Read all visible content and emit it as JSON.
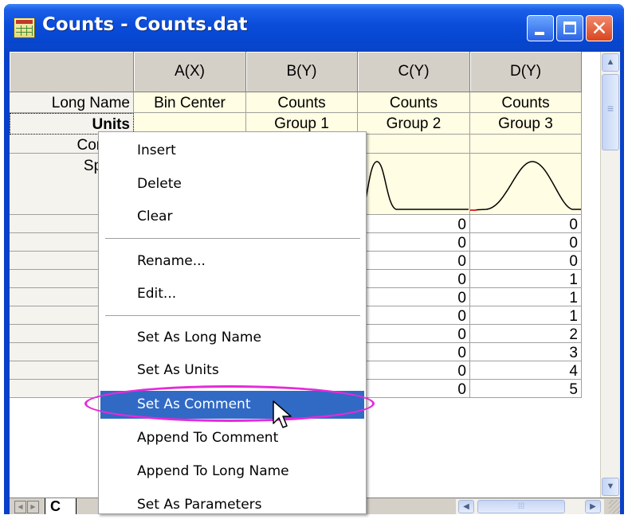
{
  "window": {
    "title": "Counts - Counts.dat",
    "buttons": {
      "minimize": "minimize-icon",
      "maximize": "maximize-icon",
      "close": "close-icon"
    }
  },
  "worksheet": {
    "columns": [
      "A(X)",
      "B(Y)",
      "C(Y)",
      "D(Y)"
    ],
    "row_labels": [
      "Long Name",
      "Units",
      "Comme",
      "Sparkli"
    ],
    "long_names": [
      "Bin Center",
      "Counts",
      "Counts",
      "Counts"
    ],
    "units": [
      "",
      "Group 1",
      "Group 2",
      "Group 3"
    ],
    "column_c_values": [
      "0",
      "0",
      "0",
      "0",
      "0",
      "0",
      "0",
      "0",
      "0",
      "0"
    ],
    "column_d_values": [
      "0",
      "0",
      "0",
      "1",
      "1",
      "1",
      "2",
      "3",
      "4",
      "5"
    ],
    "sheet_tab": "C"
  },
  "context_menu": {
    "items": [
      "Insert",
      "Delete",
      "Clear",
      "Rename...",
      "Edit...",
      "Set As Long Name",
      "Set As Units",
      "Set As Comment",
      "Append To Comment",
      "Append To Long Name",
      "Set As Parameters"
    ],
    "highlighted": "Set As Comment"
  },
  "colors": {
    "highlight_ellipse": "#e629d9",
    "selection": "#316ac5",
    "metadata_fill": "#fffde3"
  }
}
